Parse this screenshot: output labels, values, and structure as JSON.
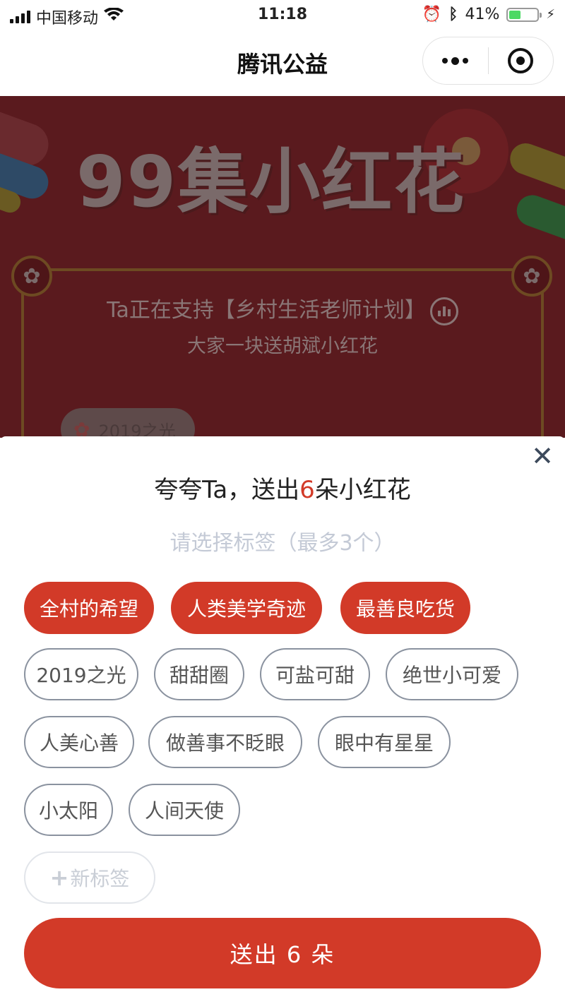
{
  "status_bar": {
    "carrier": "中国移动",
    "time": "11:18",
    "battery": "41%",
    "battery_level": 0.41
  },
  "nav": {
    "title": "腾讯公益"
  },
  "banner": {
    "title": "99集小红花",
    "line1": "Ta正在支持【乡村生活老师计划】",
    "line2": "大家一块送胡斌小红花",
    "chip": "2019之光"
  },
  "sheet": {
    "title_prefix": "夸夸Ta，送出",
    "title_count": "6",
    "title_suffix": "朵小红花",
    "subtitle": "请选择标签（最多3个）",
    "selected_tags": [
      "全村的希望",
      "人类美学奇迹",
      "最善良吃货"
    ],
    "tags": [
      "2019之光",
      "甜甜圈",
      "可盐可甜",
      "绝世小可爱",
      "人美心善",
      "做善事不眨眼",
      "眼中有星星",
      "小太阳",
      "人间天使"
    ],
    "new_tag": "新标签",
    "submit": "送出 6 朵"
  }
}
